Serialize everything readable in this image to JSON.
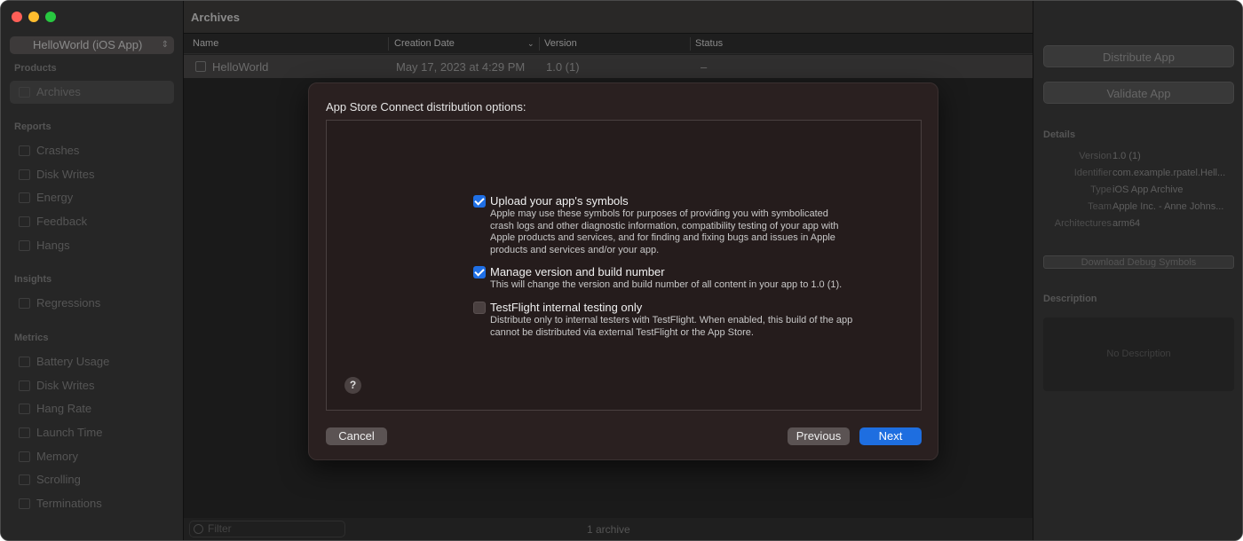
{
  "window": {
    "traffic_colors": [
      "#ff5f57",
      "#febc2e",
      "#28c840"
    ]
  },
  "sidebar": {
    "scheme": "HelloWorld (iOS App)",
    "sections": [
      {
        "title": "Products",
        "items": [
          {
            "label": "Archives",
            "selected": true,
            "icon": "archive-icon"
          }
        ]
      },
      {
        "title": "Reports",
        "items": [
          {
            "label": "Crashes",
            "icon": "crash-icon"
          },
          {
            "label": "Disk Writes",
            "icon": "disk-icon"
          },
          {
            "label": "Energy",
            "icon": "energy-icon"
          },
          {
            "label": "Feedback",
            "icon": "feedback-icon"
          },
          {
            "label": "Hangs",
            "icon": "hourglass-icon"
          }
        ]
      },
      {
        "title": "Insights",
        "items": [
          {
            "label": "Regressions",
            "icon": "regressions-icon"
          }
        ]
      },
      {
        "title": "Metrics",
        "items": [
          {
            "label": "Battery Usage",
            "icon": "battery-icon"
          },
          {
            "label": "Disk Writes",
            "icon": "disk-icon"
          },
          {
            "label": "Hang Rate",
            "icon": "hourglass-icon"
          },
          {
            "label": "Launch Time",
            "icon": "launch-icon"
          },
          {
            "label": "Memory",
            "icon": "memory-icon"
          },
          {
            "label": "Scrolling",
            "icon": "scroll-icon"
          },
          {
            "label": "Terminations",
            "icon": "terminations-icon"
          }
        ]
      }
    ],
    "filter_placeholder": "Filter"
  },
  "main": {
    "title": "Archives",
    "columns": [
      "Name",
      "Creation Date",
      "Version",
      "Status"
    ],
    "rows": [
      {
        "name": "HelloWorld",
        "date": "May 17, 2023 at 4:29 PM",
        "version": "1.0 (1)",
        "status": "–"
      }
    ],
    "footer_count": "1 archive"
  },
  "right_panel": {
    "distribute_label": "Distribute App",
    "validate_label": "Validate App",
    "details_title": "Details",
    "details": [
      {
        "label": "Version",
        "value": "1.0 (1)"
      },
      {
        "label": "Identifier",
        "value": "com.example.rpatel.Hell..."
      },
      {
        "label": "Type",
        "value": "iOS App Archive"
      },
      {
        "label": "Team",
        "value": "Apple Inc. - Anne Johns..."
      },
      {
        "label": "Architectures",
        "value": "arm64"
      }
    ],
    "download_symbols_label": "Download Debug Symbols",
    "description_title": "Description",
    "description_placeholder": "No Description"
  },
  "dialog": {
    "title": "App Store Connect distribution options:",
    "options": [
      {
        "checked": true,
        "title": "Upload your app's symbols",
        "description": "Apple may use these symbols for purposes of providing you with symbolicated crash logs and other diagnostic information, compatibility testing of your app with Apple products and services, and for finding and fixing bugs and issues in Apple products and services and/or your app."
      },
      {
        "checked": true,
        "title": "Manage version and build number",
        "description": "This will change the version and build number of all content in your app to 1.0 (1)."
      },
      {
        "checked": false,
        "title": "TestFlight internal testing only",
        "description": "Distribute only to internal testers with TestFlight. When enabled, this build of the app cannot be distributed via external TestFlight or the App Store."
      }
    ],
    "help_label": "?",
    "cancel_label": "Cancel",
    "previous_label": "Previous",
    "next_label": "Next"
  }
}
